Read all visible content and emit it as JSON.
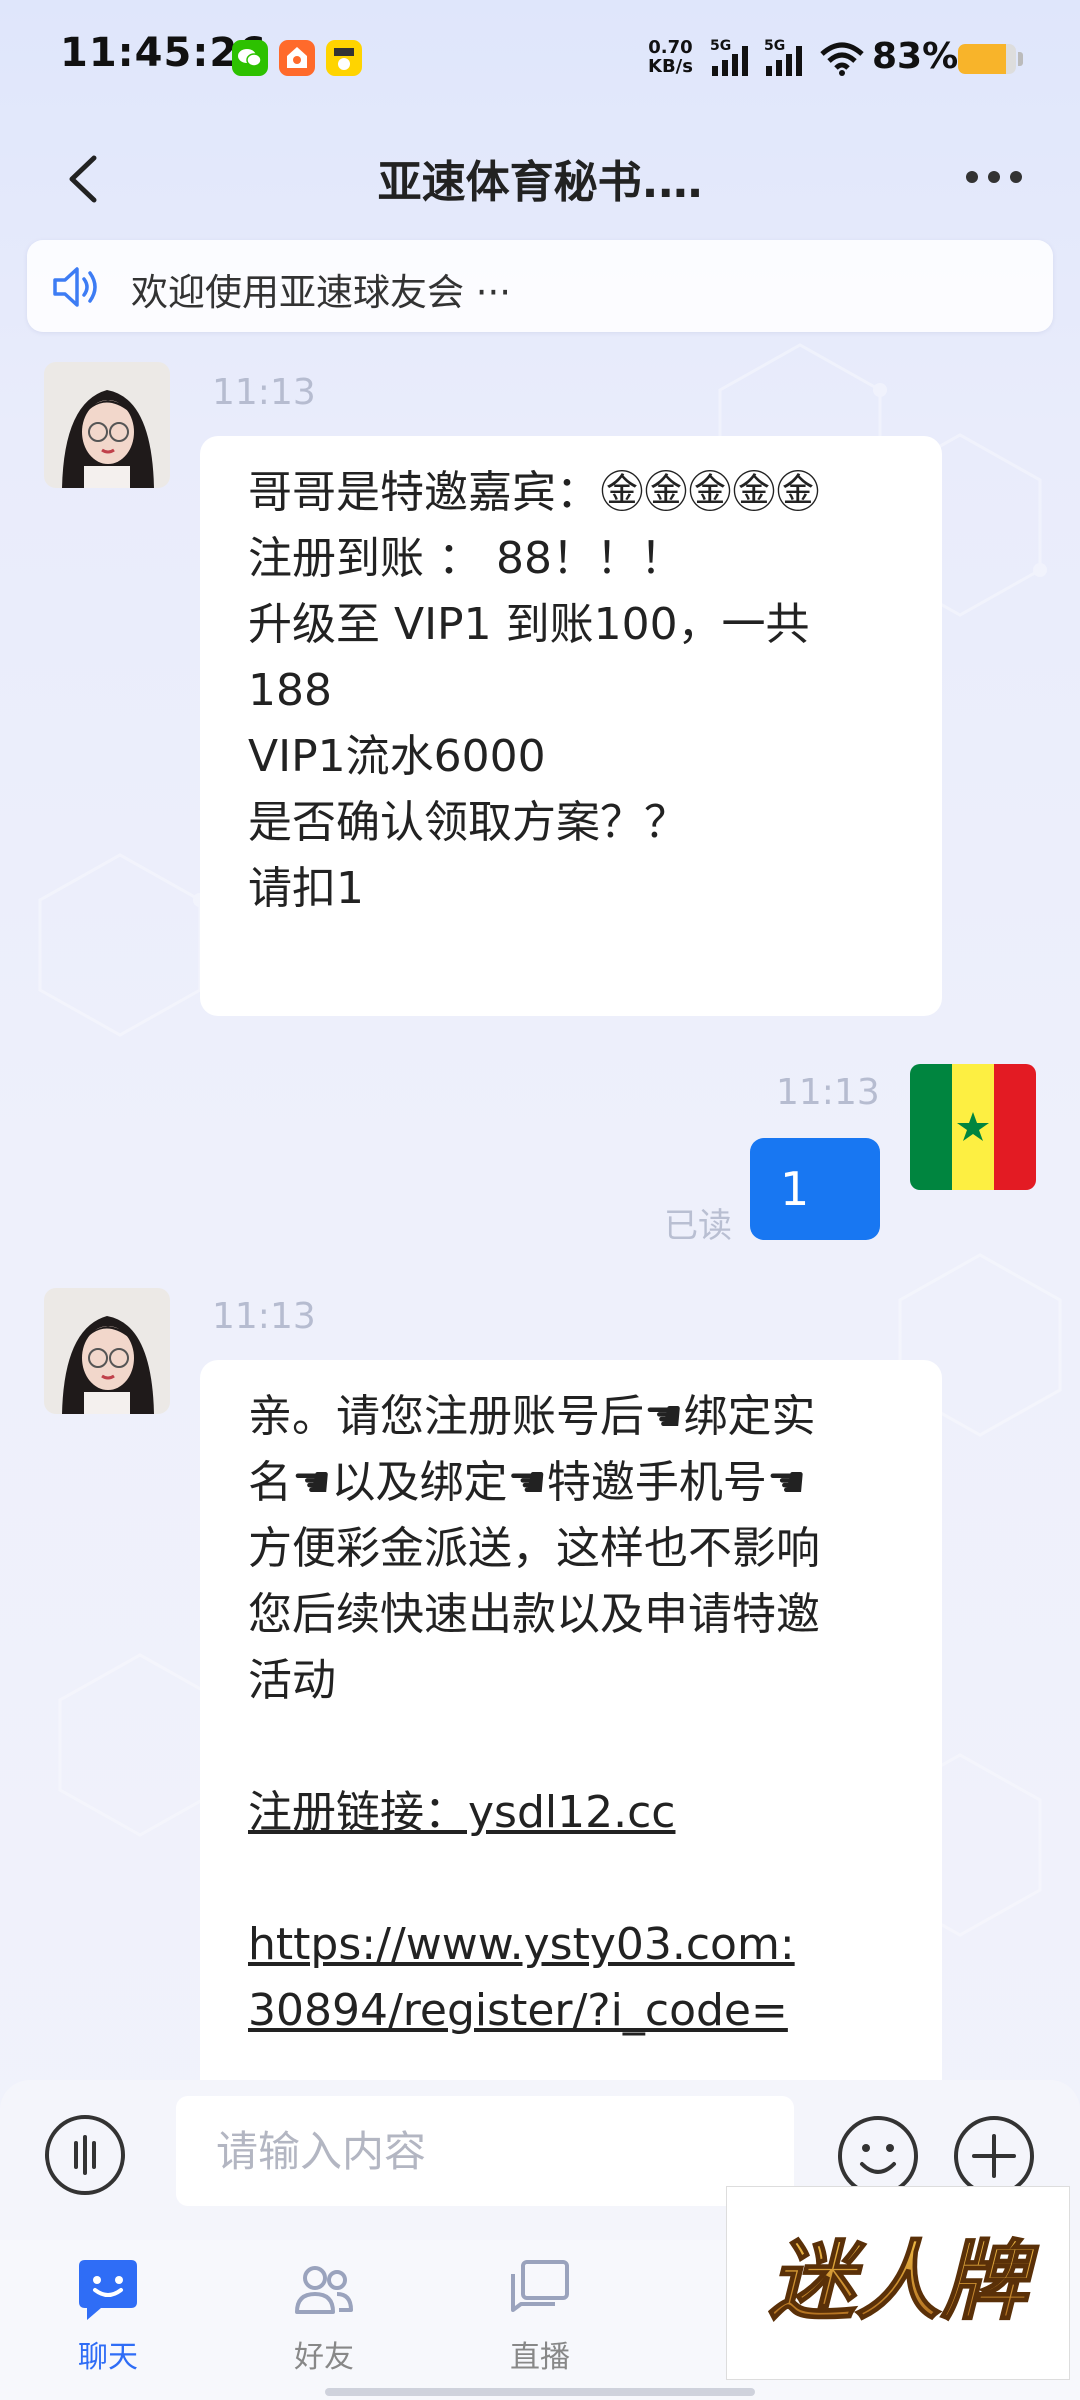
{
  "status_bar": {
    "time": "11:45:26",
    "net_speed_value": "0.70",
    "net_speed_unit": "KB/s",
    "sim1": "5G",
    "sim2": "5G",
    "battery_percent_label": "83%",
    "battery_level": 0.83
  },
  "header": {
    "title": "亚速体育秘书.…"
  },
  "notice": {
    "text": "欢迎使用亚速球友会 ···"
  },
  "messages": [
    {
      "time": "11:13",
      "lines": [
        "哥哥是特邀嘉宾：㊎㊎㊎㊎㊎",
        "注册到账 ： 88！！！",
        "升级至 VIP1 到账100，一共",
        "188",
        "VIP1流水6000",
        "是否确认领取方案？？",
        "请扣1"
      ]
    },
    {
      "time": "11:13",
      "text": "1",
      "read_state": "已读"
    },
    {
      "time": "11:13",
      "lines": [
        "亲。请您注册账号后☚绑定实",
        "名☚以及绑定☚特邀手机号☚",
        "方便彩金派送，这样也不影响",
        "您后续快速出款以及申请特邀",
        "活动"
      ],
      "register_link": "注册链接：ysdl12.cc",
      "url_line1": "https://www.ysty03.com:",
      "url_line2": "30894/register/?i_code="
    }
  ],
  "input": {
    "placeholder": "请输入内容"
  },
  "tabs": [
    {
      "label": "聊天",
      "active": true
    },
    {
      "label": "好友",
      "active": false
    },
    {
      "label": "直播",
      "active": false
    }
  ],
  "watermark": {
    "text": "迷人牌"
  },
  "colors": {
    "accent": "#2f6df6",
    "outgoing_bubble": "#1877f2",
    "battery": "#f8b42a"
  }
}
